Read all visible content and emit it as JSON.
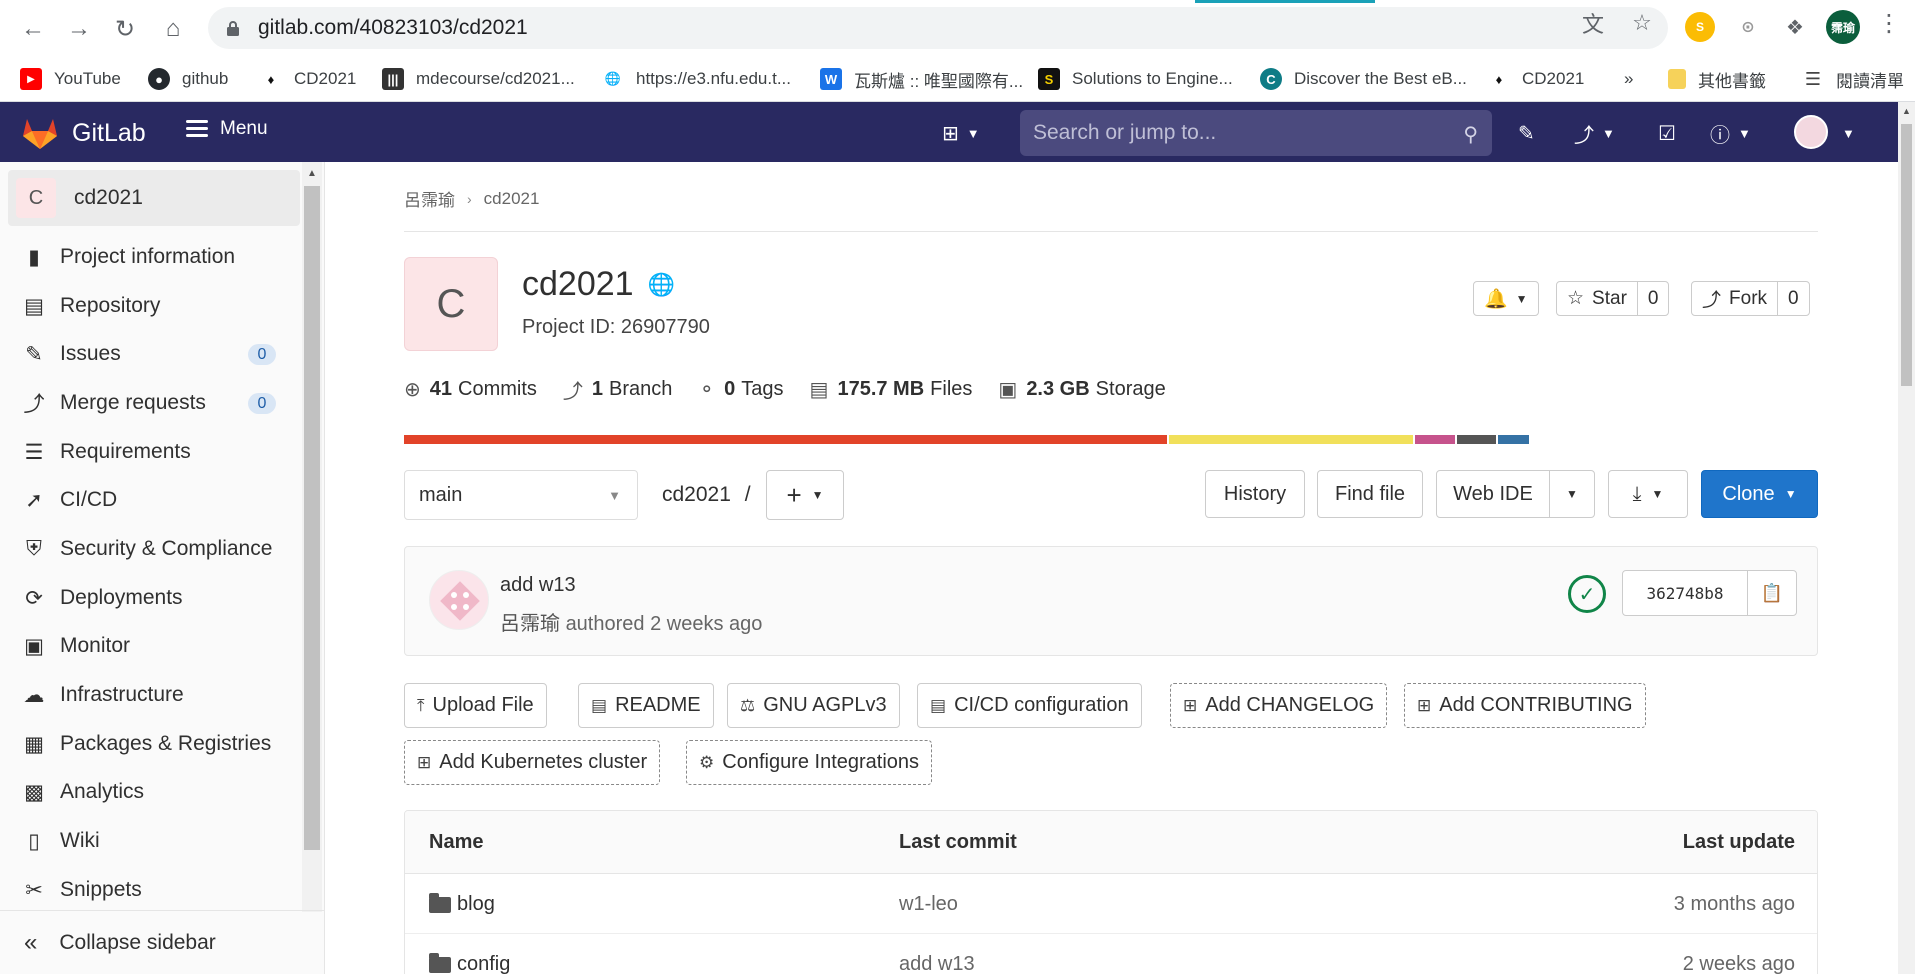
{
  "browser": {
    "url": "gitlab.com/40823103/cd2021",
    "bookmarks": [
      {
        "label": "YouTube",
        "icon": "youtube-icon"
      },
      {
        "label": "github",
        "icon": "github-icon"
      },
      {
        "label": "CD2021",
        "icon": "cd2021-icon"
      },
      {
        "label": "mdecourse/cd2021...",
        "icon": "mdecourse-icon"
      },
      {
        "label": "https://e3.nfu.edu.t...",
        "icon": "globe-icon"
      },
      {
        "label": "瓦斯爐 :: 唯聖國際有...",
        "icon": "w-icon"
      },
      {
        "label": "Solutions to Engine...",
        "icon": "s-icon"
      },
      {
        "label": "Discover the Best eB...",
        "icon": "discover-icon"
      },
      {
        "label": "CD2021",
        "icon": "cd2021-icon"
      }
    ],
    "overflow": "»",
    "other_bookmarks": "其他書籤",
    "reading_list": "閱讀清單",
    "profile_initials": "霈瑜"
  },
  "header": {
    "brand": "GitLab",
    "menu_label": "Menu",
    "search_placeholder": "Search or jump to..."
  },
  "sidebar": {
    "project_initial": "C",
    "project_name": "cd2021",
    "items": [
      {
        "label": "Project information",
        "icon": "info-icon"
      },
      {
        "label": "Repository",
        "icon": "doc-icon"
      },
      {
        "label": "Issues",
        "icon": "issues-icon",
        "badge": "0"
      },
      {
        "label": "Merge requests",
        "icon": "merge-icon",
        "badge": "0"
      },
      {
        "label": "Requirements",
        "icon": "list-icon"
      },
      {
        "label": "CI/CD",
        "icon": "rocket-icon"
      },
      {
        "label": "Security & Compliance",
        "icon": "shield-icon"
      },
      {
        "label": "Deployments",
        "icon": "deploy-icon"
      },
      {
        "label": "Monitor",
        "icon": "monitor-icon"
      },
      {
        "label": "Infrastructure",
        "icon": "cloud-icon"
      },
      {
        "label": "Packages & Registries",
        "icon": "package-icon"
      },
      {
        "label": "Analytics",
        "icon": "chart-icon"
      },
      {
        "label": "Wiki",
        "icon": "book-icon"
      },
      {
        "label": "Snippets",
        "icon": "scissors-icon"
      }
    ],
    "collapse_label": "Collapse sidebar"
  },
  "breadcrumb": {
    "owner": "呂霈瑜",
    "project": "cd2021"
  },
  "project": {
    "initial": "C",
    "name": "cd2021",
    "id_text": "Project ID: 26907790",
    "star_label": "Star",
    "star_count": "0",
    "fork_label": "Fork",
    "fork_count": "0"
  },
  "stats": {
    "commits_num": "41",
    "commits_label": "Commits",
    "branch_num": "1",
    "branch_label": "Branch",
    "tags_num": "0",
    "tags_label": "Tags",
    "files_num": "175.7 MB",
    "files_label": "Files",
    "storage_num": "2.3 GB",
    "storage_label": "Storage"
  },
  "language_bar": [
    {
      "color": "#e24329",
      "share": 0.669
    },
    {
      "color": "#f1e05a",
      "share": 0.214
    },
    {
      "color": "#c6538c",
      "share": 0.035
    },
    {
      "color": "#555555",
      "share": 0.034
    },
    {
      "color": "#3572a5",
      "share": 0.027
    }
  ],
  "repo_toolbar": {
    "branch": "main",
    "path": "cd2021",
    "path_sep": "/",
    "history": "History",
    "find_file": "Find file",
    "web_ide": "Web IDE",
    "clone": "Clone"
  },
  "last_commit": {
    "title": "add w13",
    "author": "呂霈瑜",
    "meta": "authored 2 weeks ago",
    "sha": "362748b8"
  },
  "quick_actions": [
    {
      "label": "Upload File",
      "icon": "upload-icon",
      "dashed": false
    },
    {
      "label": "README",
      "icon": "file-icon",
      "dashed": false
    },
    {
      "label": "GNU AGPLv3",
      "icon": "scale-icon",
      "dashed": false
    },
    {
      "label": "CI/CD configuration",
      "icon": "file-icon",
      "dashed": false
    },
    {
      "label": "Add CHANGELOG",
      "icon": "plus-square-icon",
      "dashed": true
    },
    {
      "label": "Add CONTRIBUTING",
      "icon": "plus-square-icon",
      "dashed": true
    },
    {
      "label": "Add Kubernetes cluster",
      "icon": "plus-square-icon",
      "dashed": true
    },
    {
      "label": "Configure Integrations",
      "icon": "gear-icon",
      "dashed": true
    }
  ],
  "file_table": {
    "headers": {
      "name": "Name",
      "last_commit": "Last commit",
      "last_update": "Last update"
    },
    "rows": [
      {
        "name": "blog",
        "commit": "w1-leo",
        "updated": "3 months ago"
      },
      {
        "name": "config",
        "commit": "add w13",
        "updated": "2 weeks ago"
      }
    ]
  }
}
